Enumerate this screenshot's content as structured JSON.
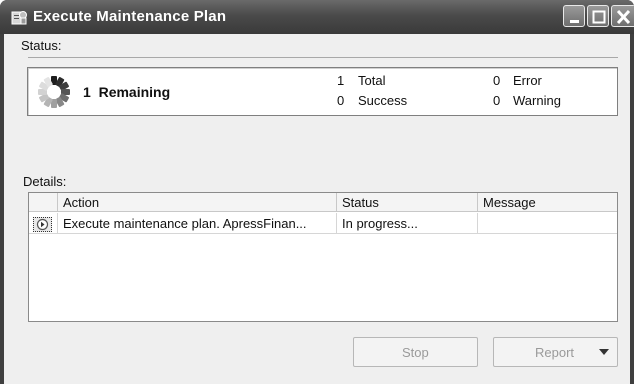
{
  "window": {
    "title": "Execute Maintenance Plan",
    "controls": [
      "minimize-icon",
      "maximize-icon",
      "close-icon"
    ]
  },
  "status_section": {
    "label": "Status:",
    "remaining_count": "1",
    "remaining_label": "Remaining",
    "total_count": "1",
    "total_label": "Total",
    "success_count": "0",
    "success_label": "Success",
    "error_count": "0",
    "error_label": "Error",
    "warning_count": "0",
    "warning_label": "Warning"
  },
  "details_section": {
    "label": "Details:",
    "columns": [
      "Action",
      "Status",
      "Message"
    ],
    "rows": [
      {
        "action": "Execute maintenance plan. ApressFinan...",
        "status": "In progress...",
        "message": ""
      }
    ]
  },
  "buttons": {
    "stop": "Stop",
    "report": "Report"
  },
  "colors": {
    "titlebar": "#4a4a4a",
    "client": "#efefef",
    "disabled_text": "#9a9a9a"
  }
}
